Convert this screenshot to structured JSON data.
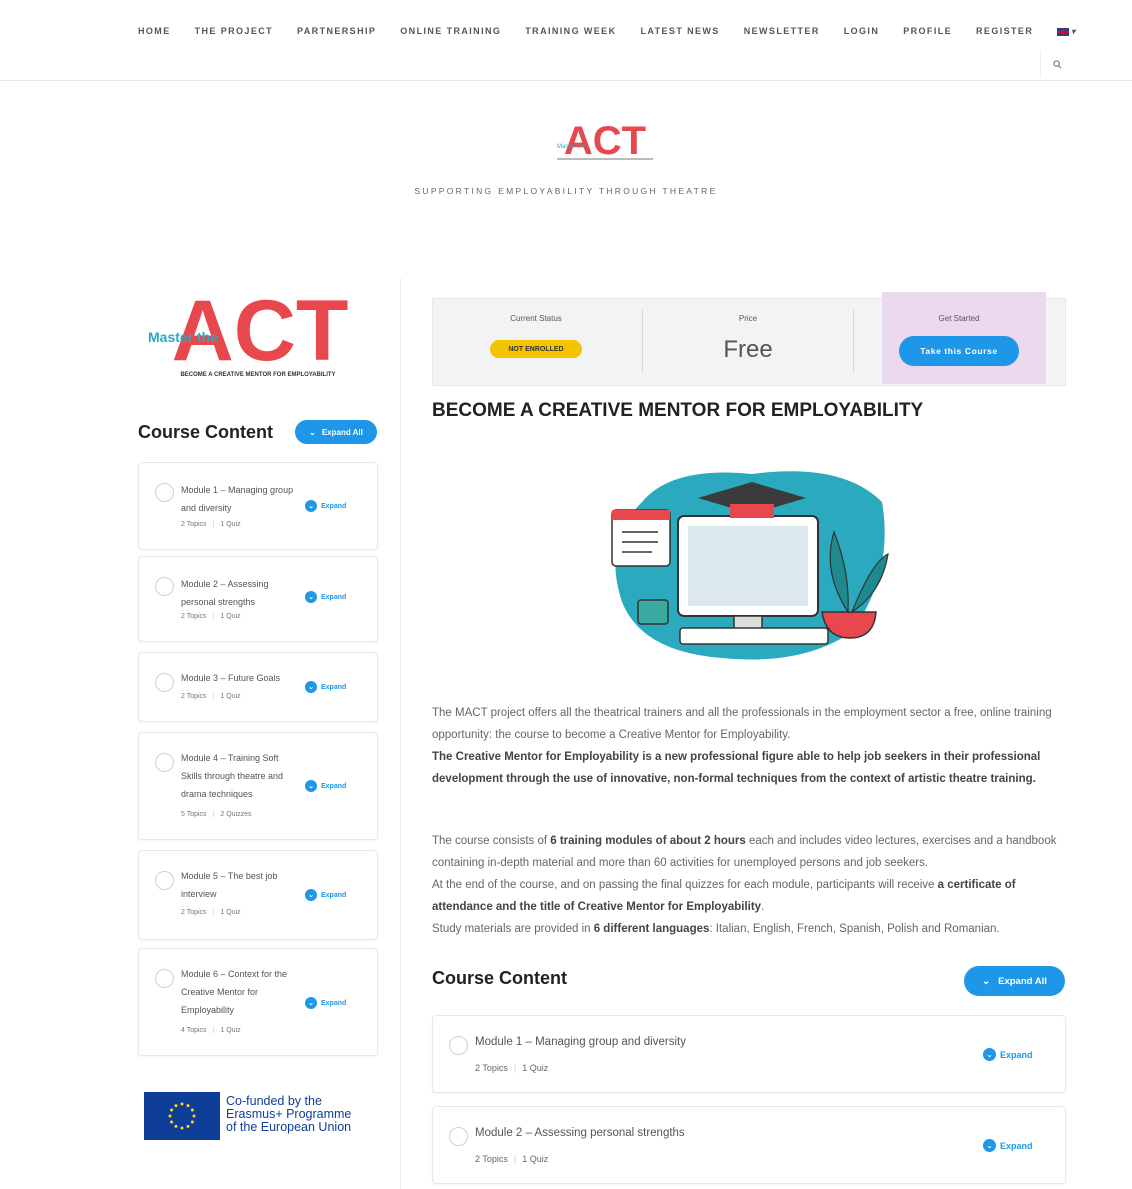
{
  "nav": {
    "items": [
      "HOME",
      "THE PROJECT",
      "PARTNERSHIP",
      "ONLINE TRAINING",
      "TRAINING WEEK",
      "LATEST NEWS",
      "NEWSLETTER",
      "LOGIN",
      "PROFILE",
      "REGISTER"
    ],
    "language_icon": "uk-flag-icon",
    "search_icon": "search-icon"
  },
  "header": {
    "logo_text": "ACT",
    "logo_prefix": "Master the",
    "tagline": "SUPPORTING EMPLOYABILITY THROUGH THEATRE"
  },
  "sidebar": {
    "logo_text": "ACT",
    "logo_prefix": "Master the",
    "logo_subtitle": "BECOME A CREATIVE MENTOR FOR EMPLOYABILITY",
    "course_content_title": "Course Content",
    "expand_all_label": "Expand All",
    "modules": [
      {
        "title": "Module 1 – Managing group and diversity",
        "topics": "2 Topics",
        "quiz": "1 Quiz",
        "expand": "Expand"
      },
      {
        "title": "Module 2 – Assessing personal strengths",
        "topics": "2 Topics",
        "quiz": "1 Quiz",
        "expand": "Expand"
      },
      {
        "title": "Module 3 – Future Goals",
        "topics": "2 Topics",
        "quiz": "1 Quiz",
        "expand": "Expand"
      },
      {
        "title": "Module 4 – Training Soft Skills through theatre and drama techniques",
        "topics": "5 Topics",
        "quiz": "2 Quizzes",
        "expand": "Expand"
      },
      {
        "title": "Module 5 – The best job interview",
        "topics": "2 Topics",
        "quiz": "1 Quiz",
        "expand": "Expand"
      },
      {
        "title": "Module 6 – Context for the Creative Mentor for Employability",
        "topics": "4 Topics",
        "quiz": "1 Quiz",
        "expand": "Expand"
      }
    ],
    "eu_text": [
      "Co-funded by the",
      "Erasmus+ Programme",
      "of the European Union"
    ]
  },
  "status": {
    "current_status_label": "Current Status",
    "current_status_value": "NOT ENROLLED",
    "price_label": "Price",
    "price_value": "Free",
    "get_started_label": "Get Started",
    "take_course_label": "Take this Course"
  },
  "course": {
    "title": "BECOME A CREATIVE MENTOR FOR EMPLOYABILITY",
    "p1": "The MACT project offers all the theatrical trainers and all the professionals in the employment sector a free, online training opportunity: the course to become a Creative Mentor for Employability.",
    "p1_bold": "The Creative Mentor for Employability is a new professional figure able to help job seekers in their professional development through the use of innovative, non-formal techniques from the context of artistic theatre training.",
    "p2_a": "The course consists of ",
    "p2_b": "6 training modules of about 2 hours",
    "p2_c": " each and includes video lectures, exercises and a handbook containing in-depth material and more than 60 activities for unemployed persons and job seekers.",
    "p3_a": "At the end of the course, and on passing the final quizzes for each module, participants will receive ",
    "p3_b": "a certificate of attendance and the title of Creative Mentor for Employability",
    "p3_c": ".",
    "p4_a": "Study materials are provided in ",
    "p4_b": "6 different languages",
    "p4_c": ": Italian, English, French, Spanish, Polish and Romanian."
  },
  "main_content": {
    "title": "Course Content",
    "expand_all_label": "Expand All",
    "modules": [
      {
        "title": "Module 1 – Managing group and diversity",
        "topics": "2 Topics",
        "quiz": "1 Quiz",
        "expand": "Expand"
      },
      {
        "title": "Module 2 – Assessing personal strengths",
        "topics": "2 Topics",
        "quiz": "1 Quiz",
        "expand": "Expand"
      }
    ]
  },
  "colors": {
    "brand_red": "#e8474d",
    "brand_blue": "#1e97e8",
    "teal": "#2aa9bf",
    "badge_yellow": "#f5c400"
  }
}
